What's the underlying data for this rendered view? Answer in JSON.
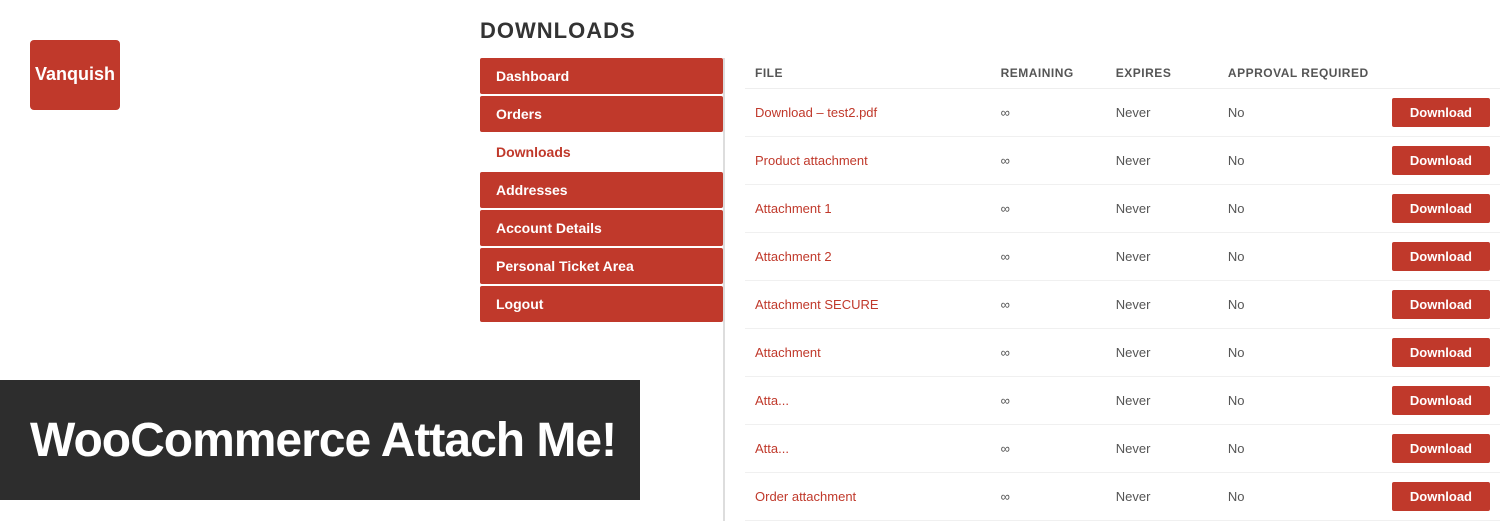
{
  "logo": {
    "text": "Vanquish"
  },
  "page_title": "DOWNLOADS",
  "sidebar": {
    "items": [
      {
        "label": "Dashboard",
        "state": "active"
      },
      {
        "label": "Orders",
        "state": "active"
      },
      {
        "label": "Downloads",
        "state": "current"
      },
      {
        "label": "Addresses",
        "state": "active"
      },
      {
        "label": "Account Details",
        "state": "active"
      },
      {
        "label": "Personal Ticket Area",
        "state": "active"
      },
      {
        "label": "Logout",
        "state": "active"
      }
    ]
  },
  "table": {
    "headers": [
      "FILE",
      "REMAINING",
      "EXPIRES",
      "APPROVAL REQUIRED",
      ""
    ],
    "rows": [
      {
        "file": "Download – test2.pdf",
        "remaining": "∞",
        "expires": "Never",
        "approval": "No"
      },
      {
        "file": "Product attachment",
        "remaining": "∞",
        "expires": "Never",
        "approval": "No"
      },
      {
        "file": "Attachment 1",
        "remaining": "∞",
        "expires": "Never",
        "approval": "No"
      },
      {
        "file": "Attachment 2",
        "remaining": "∞",
        "expires": "Never",
        "approval": "No"
      },
      {
        "file": "Attachment SECURE",
        "remaining": "∞",
        "expires": "Never",
        "approval": "No"
      },
      {
        "file": "Attachment",
        "remaining": "∞",
        "expires": "Never",
        "approval": "No"
      },
      {
        "file": "Atta...",
        "remaining": "∞",
        "expires": "Never",
        "approval": "No"
      },
      {
        "file": "Atta...",
        "remaining": "∞",
        "expires": "Never",
        "approval": "No"
      },
      {
        "file": "Order attachment",
        "remaining": "∞",
        "expires": "Never",
        "approval": "No"
      }
    ],
    "download_button_label": "Download"
  },
  "banner": {
    "text": "WooCommerce Attach Me!"
  },
  "colors": {
    "accent": "#c0392b",
    "dark": "#2d2d2d",
    "white": "#ffffff"
  }
}
